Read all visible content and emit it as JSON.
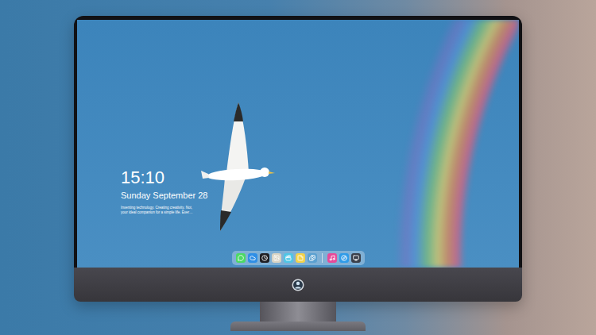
{
  "screen": {
    "clock": "15:10",
    "date": "Sunday September 28",
    "tagline": [
      "Inventing technology. Creating creativity. Not,",
      "your ideal companion for a simple life. Ever…"
    ]
  },
  "dock": {
    "items": [
      {
        "kind": "app",
        "color": "#4cd964"
      },
      {
        "kind": "app",
        "color": "#2f8fe6"
      },
      {
        "kind": "app",
        "color": "#1f1f24"
      },
      {
        "kind": "app",
        "color": "#d9d4c4"
      },
      {
        "kind": "app",
        "color": "#4fc6e6"
      },
      {
        "kind": "app",
        "color": "#f2d24a"
      },
      {
        "kind": "app",
        "color": "#5aa0d0"
      },
      {
        "kind": "divider",
        "color": "#e8eef4"
      },
      {
        "kind": "app",
        "color": "#e64a9a"
      },
      {
        "kind": "app",
        "color": "#2f9be8"
      },
      {
        "kind": "app",
        "color": "#3a3f4a"
      }
    ]
  }
}
